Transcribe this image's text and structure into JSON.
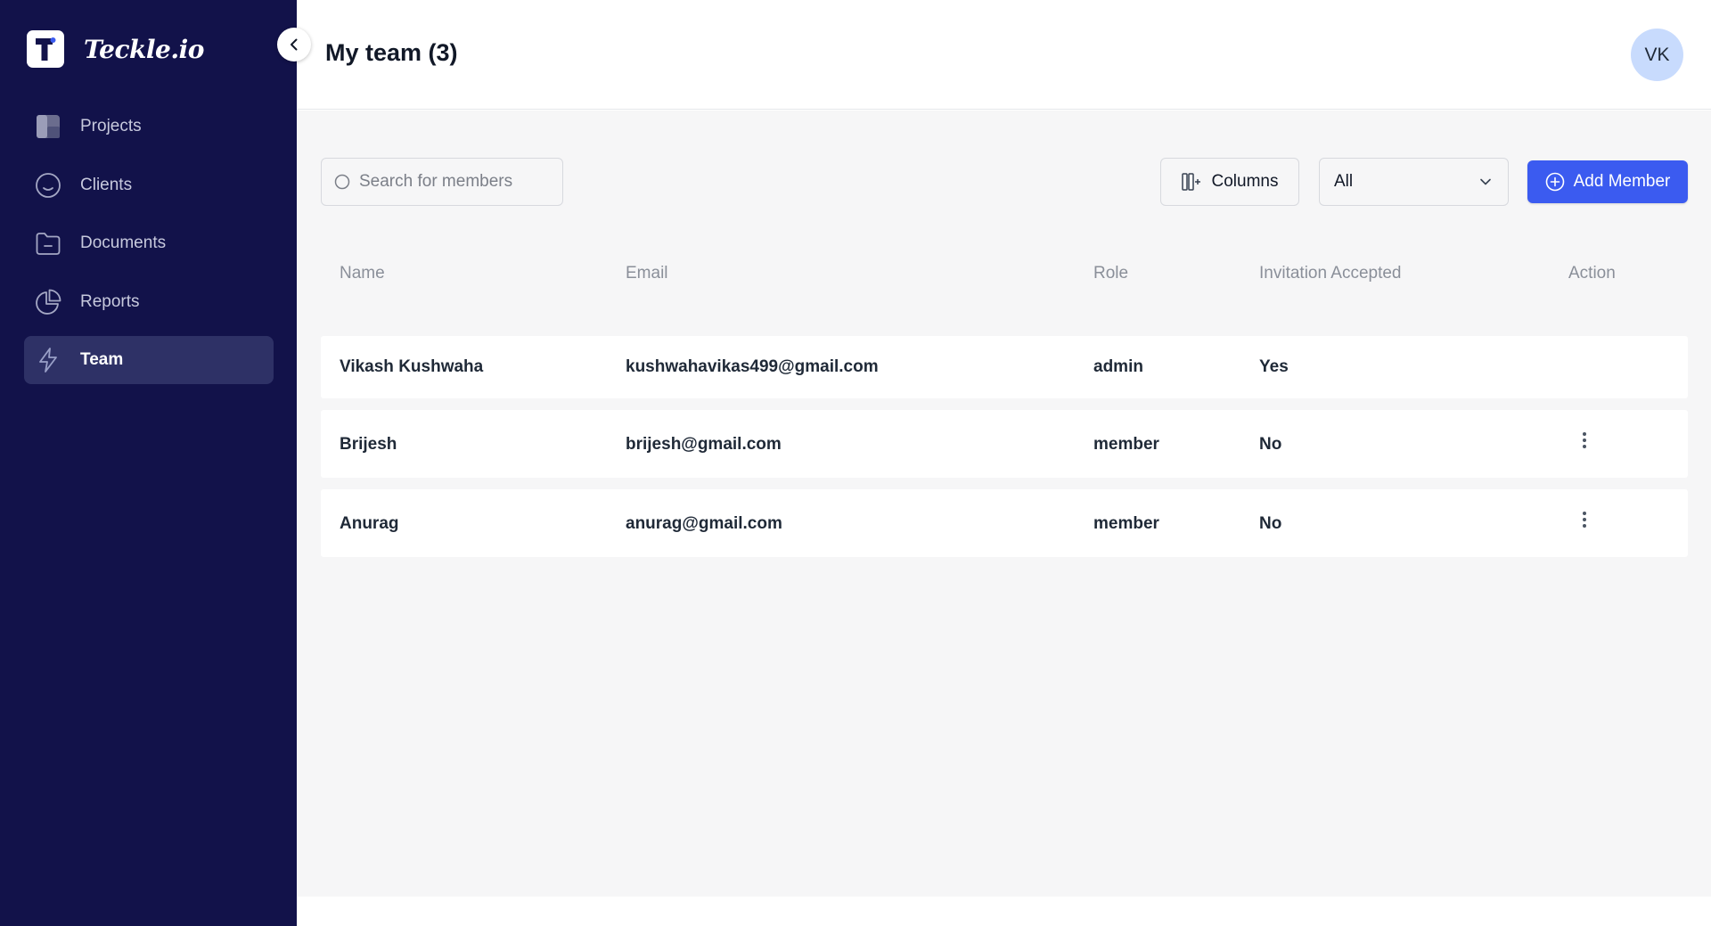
{
  "brand": {
    "name": "Teckle.io"
  },
  "sidebar": {
    "items": [
      {
        "label": "Projects",
        "icon": "grid-icon",
        "active": false
      },
      {
        "label": "Clients",
        "icon": "smiley-icon",
        "active": false
      },
      {
        "label": "Documents",
        "icon": "folder-icon",
        "active": false
      },
      {
        "label": "Reports",
        "icon": "pie-chart-icon",
        "active": false
      },
      {
        "label": "Team",
        "icon": "lightning-icon",
        "active": true
      }
    ]
  },
  "header": {
    "title": "My team (3)",
    "avatar_initials": "VK"
  },
  "toolbar": {
    "search_placeholder": "Search for members",
    "columns_label": "Columns",
    "filter_value": "All",
    "add_label": "Add Member"
  },
  "table": {
    "columns": [
      "Name",
      "Email",
      "Role",
      "Invitation Accepted",
      "Action"
    ],
    "rows": [
      {
        "name": "Vikash Kushwaha",
        "email": "kushwahavikas499@gmail.com",
        "role": "admin",
        "accepted": "Yes",
        "has_action": false
      },
      {
        "name": "Brijesh",
        "email": "brijesh@gmail.com",
        "role": "member",
        "accepted": "No",
        "has_action": true
      },
      {
        "name": "Anurag",
        "email": "anurag@gmail.com",
        "role": "member",
        "accepted": "No",
        "has_action": true
      }
    ]
  },
  "colors": {
    "sidebar_bg": "#12124a",
    "active_item_bg": "#2e3166",
    "accent": "#3b5bf0",
    "avatar_bg": "#c8dbfd"
  }
}
